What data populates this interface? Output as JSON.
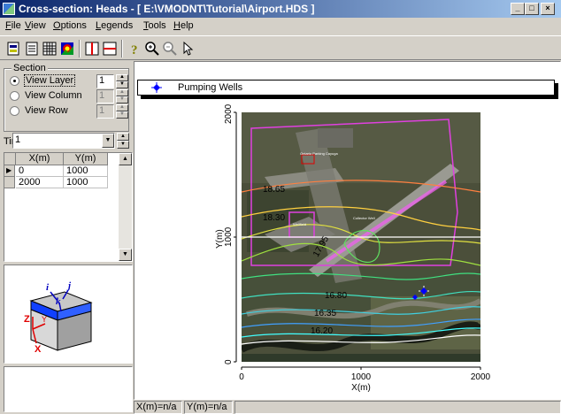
{
  "window": {
    "title": "Cross-section: Heads - [ E:\\VMODNT\\Tutorial\\Airport.HDS ]",
    "controls": [
      "_",
      "□",
      "×"
    ]
  },
  "menu": [
    {
      "label": "File",
      "key": "F",
      "rest": "ile"
    },
    {
      "label": "View",
      "key": "V",
      "rest": "iew"
    },
    {
      "label": "Options",
      "key": "O",
      "rest": "ptions"
    },
    {
      "label": "Legends",
      "key": "L",
      "rest": "egends"
    },
    {
      "label": "Tools",
      "key": "T",
      "rest": "ools"
    },
    {
      "label": "Help",
      "key": "H",
      "rest": "elp"
    }
  ],
  "section": {
    "label": "Section",
    "options": [
      {
        "label": "View Layer",
        "value": "1",
        "selected": true
      },
      {
        "label": "View Column",
        "value": "1",
        "selected": false
      },
      {
        "label": "View Row",
        "value": "1",
        "selected": false
      }
    ]
  },
  "time": {
    "label": "Time",
    "value": "1"
  },
  "grid": {
    "columns": [
      "X(m)",
      "Y(m)"
    ],
    "rows": [
      [
        "0",
        "1000"
      ],
      [
        "2000",
        "1000"
      ]
    ]
  },
  "axis_cube": {
    "labels": [
      "i",
      "j",
      "k",
      "Z",
      "Y",
      "X"
    ]
  },
  "legend": {
    "label": "Pumping Wells",
    "color": "#0000ff"
  },
  "plot": {
    "xlabel": "X(m)",
    "ylabel": "Y(m)",
    "xticks": [
      "0",
      "1000",
      "2000"
    ],
    "yticks": [
      "0",
      "1000",
      "2000"
    ],
    "contour_labels": [
      "18.65",
      "18.30",
      "17.95",
      "16.80",
      "16.35",
      "16.20"
    ],
    "map_labels": [
      "Ontario Parking Cayuga",
      "Collector Well",
      "Wellfield"
    ],
    "colors": {
      "boundary": "#e040e0",
      "section_line": "#ffffff",
      "well": "#0000ff"
    }
  },
  "status": {
    "x": "X(m)=n/a",
    "y": "Y(m)=n/a"
  }
}
